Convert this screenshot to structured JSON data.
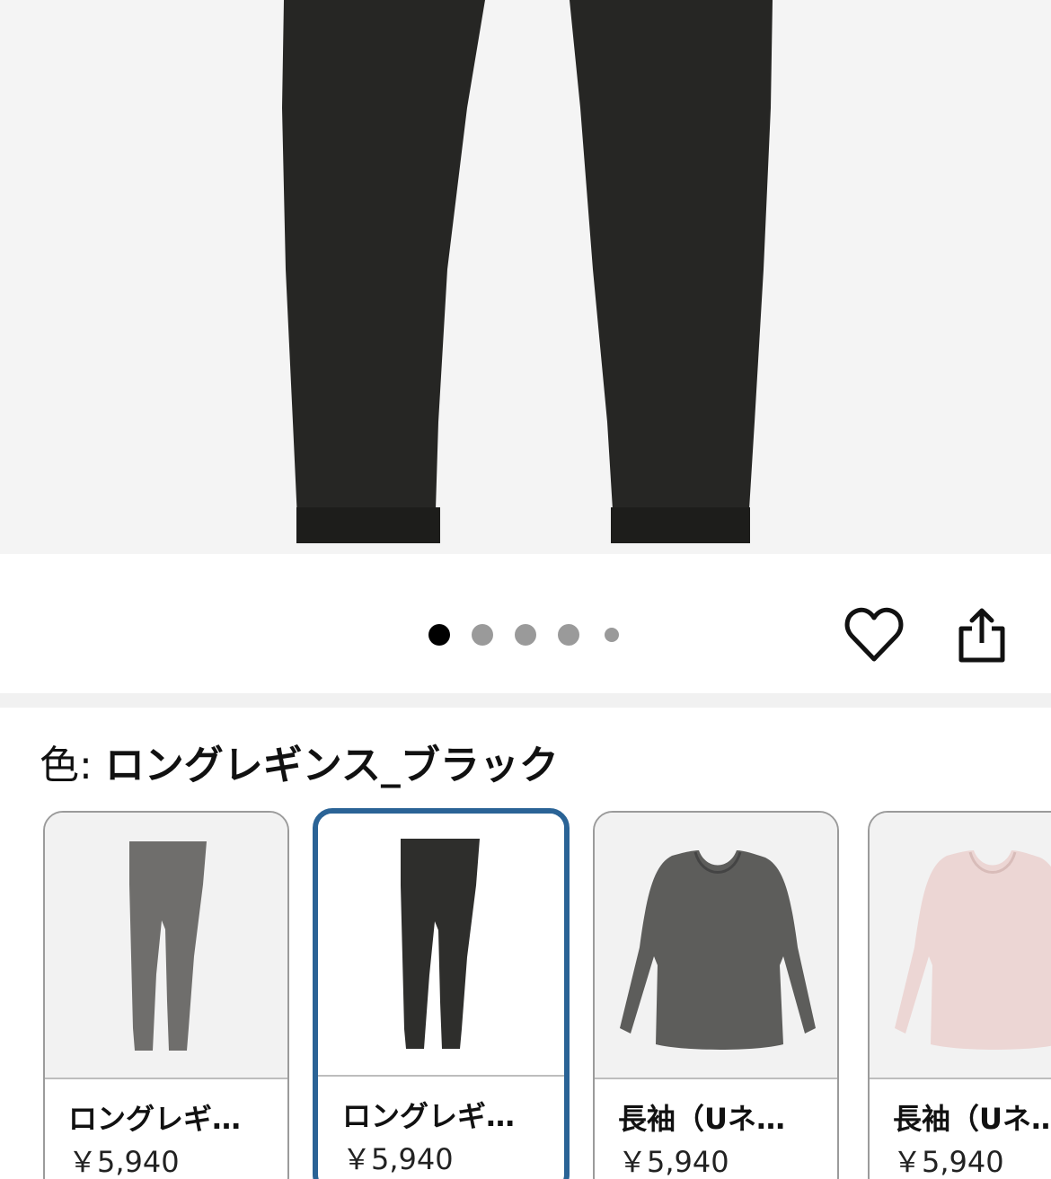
{
  "product_image": {
    "icon": "leggings-photo",
    "carousel": {
      "total": 5,
      "current": 1
    }
  },
  "actions": {
    "favorite_icon": "heart-outline-icon",
    "share_icon": "share-icon"
  },
  "color_selector": {
    "prefix": "色: ",
    "selected_value": "ロングレギンス_ブラック",
    "accent_color": "#2a6396",
    "swatches": [
      {
        "name": "ロングレギ…",
        "price": "￥5,940",
        "image": "gray-leggings",
        "selected": false
      },
      {
        "name": "ロングレギ…",
        "price": "￥5,940",
        "image": "black-leggings",
        "selected": true
      },
      {
        "name": "長袖（Uネ…",
        "price": "￥5,940",
        "image": "gray-long-sleeve-top",
        "selected": false
      },
      {
        "name": "長袖（Uネ…",
        "price": "￥5,940",
        "image": "pink-long-sleeve-top",
        "selected": false
      }
    ]
  }
}
